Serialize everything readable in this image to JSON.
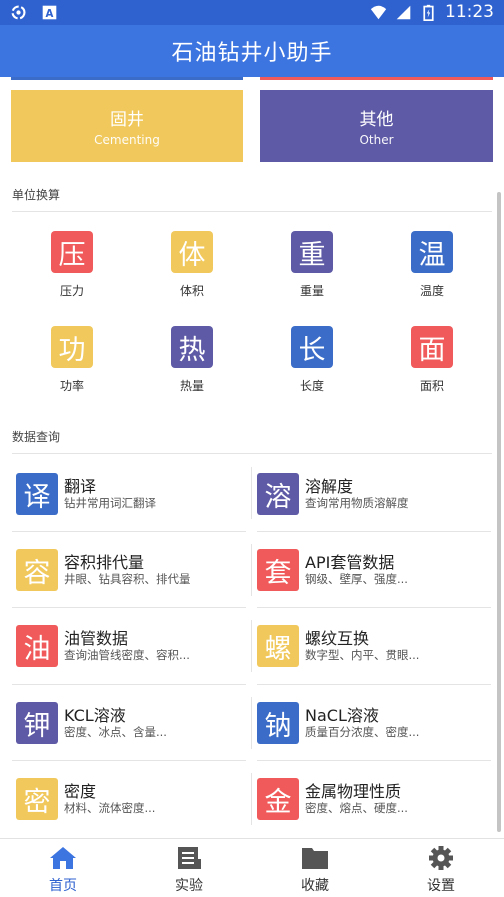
{
  "status_bar": {
    "time": "11:23"
  },
  "app_bar": {
    "title": "石油钻井小助手"
  },
  "colors": {
    "primary": "#3c74e0",
    "red": "#f05a5a",
    "yellow": "#f0c85c",
    "purple": "#5e5aa6",
    "blue": "#3a6cc8"
  },
  "categories": [
    {
      "zh": "固井",
      "en": "Cementing",
      "color": "#f0c85c"
    },
    {
      "zh": "其他",
      "en": "Other",
      "color": "#5e5aa6"
    }
  ],
  "unit_section": {
    "title": "单位换算",
    "items": [
      {
        "glyph": "压",
        "label": "压力",
        "color": "#f05a5a"
      },
      {
        "glyph": "体",
        "label": "体积",
        "color": "#f0c85c"
      },
      {
        "glyph": "重",
        "label": "重量",
        "color": "#5e5aa6"
      },
      {
        "glyph": "温",
        "label": "温度",
        "color": "#3a6cc8"
      },
      {
        "glyph": "功",
        "label": "功率",
        "color": "#f0c85c"
      },
      {
        "glyph": "热",
        "label": "热量",
        "color": "#5e5aa6"
      },
      {
        "glyph": "长",
        "label": "长度",
        "color": "#3a6cc8"
      },
      {
        "glyph": "面",
        "label": "面积",
        "color": "#f05a5a"
      }
    ]
  },
  "data_section": {
    "title": "数据查询",
    "items": [
      {
        "glyph": "译",
        "title": "翻译",
        "sub": "钻井常用词汇翻译",
        "color": "#3a6cc8"
      },
      {
        "glyph": "溶",
        "title": "溶解度",
        "sub": "查询常用物质溶解度",
        "color": "#5e5aa6"
      },
      {
        "glyph": "容",
        "title": "容积排代量",
        "sub": "井眼、钻具容积、排代量",
        "color": "#f0c85c"
      },
      {
        "glyph": "套",
        "title": "API套管数据",
        "sub": "钢级、壁厚、强度...",
        "color": "#f05a5a"
      },
      {
        "glyph": "油",
        "title": "油管数据",
        "sub": "查询油管线密度、容积...",
        "color": "#f05a5a"
      },
      {
        "glyph": "螺",
        "title": "螺纹互换",
        "sub": "数字型、内平、贯眼...",
        "color": "#f0c85c"
      },
      {
        "glyph": "钾",
        "title": "KCL溶液",
        "sub": "密度、冰点、含量...",
        "color": "#5e5aa6"
      },
      {
        "glyph": "钠",
        "title": "NaCL溶液",
        "sub": "质量百分浓度、密度...",
        "color": "#3a6cc8"
      },
      {
        "glyph": "密",
        "title": "密度",
        "sub": "材料、流体密度...",
        "color": "#f0c85c"
      },
      {
        "glyph": "金",
        "title": "金属物理性质",
        "sub": "密度、熔点、硬度...",
        "color": "#f05a5a"
      }
    ]
  },
  "bottom_nav": [
    {
      "label": "首页",
      "icon": "home-icon",
      "active": true
    },
    {
      "label": "实验",
      "icon": "list-icon",
      "active": false
    },
    {
      "label": "收藏",
      "icon": "folder-icon",
      "active": false
    },
    {
      "label": "设置",
      "icon": "gear-icon",
      "active": false
    }
  ]
}
